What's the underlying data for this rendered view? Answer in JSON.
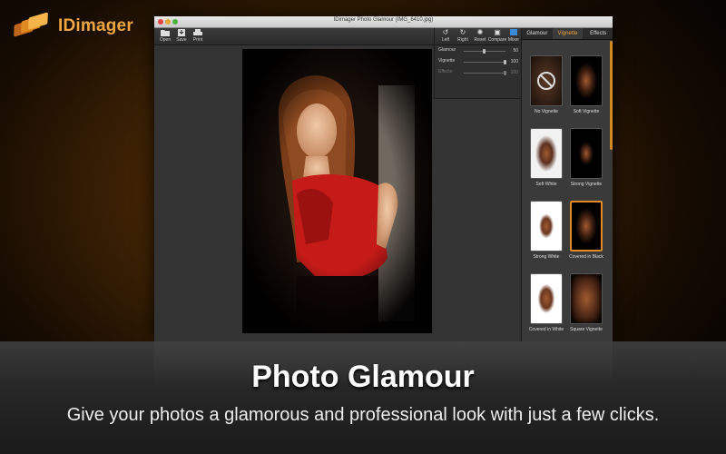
{
  "brand": {
    "name": "IDimager"
  },
  "window": {
    "title": "IDimager Photo Glamour (IMG_6410.jpg)"
  },
  "toolbar": {
    "open_label": "Open",
    "save_label": "Save",
    "print_label": "Print",
    "left_label": "Left",
    "right_label": "Right",
    "reset_label": "Reset",
    "compare_label": "Compare",
    "mixer_label": "Mixer"
  },
  "adjustments": {
    "glamour": {
      "label": "Glamour",
      "value": "50"
    },
    "vignette": {
      "label": "Vignette",
      "value": "100"
    },
    "effects": {
      "label": "Effects",
      "value": "100"
    }
  },
  "side_tabs": {
    "glamour": "Glamour",
    "vignette": "Vignette",
    "effects": "Effects",
    "active": "Vignette"
  },
  "presets": [
    {
      "label": "No Vignette"
    },
    {
      "label": "Soft Vignette"
    },
    {
      "label": "Soft White"
    },
    {
      "label": "Strong Vignette"
    },
    {
      "label": "Strong White"
    },
    {
      "label": "Covered in Black"
    },
    {
      "label": "Covered in White"
    },
    {
      "label": "Square Vignette"
    }
  ],
  "marketing": {
    "headline": "Photo Glamour",
    "subline": "Give your photos a glamorous and professional look with just a few clicks."
  },
  "colors": {
    "accent": "#f0a640",
    "selected_border": "#e08a22"
  }
}
